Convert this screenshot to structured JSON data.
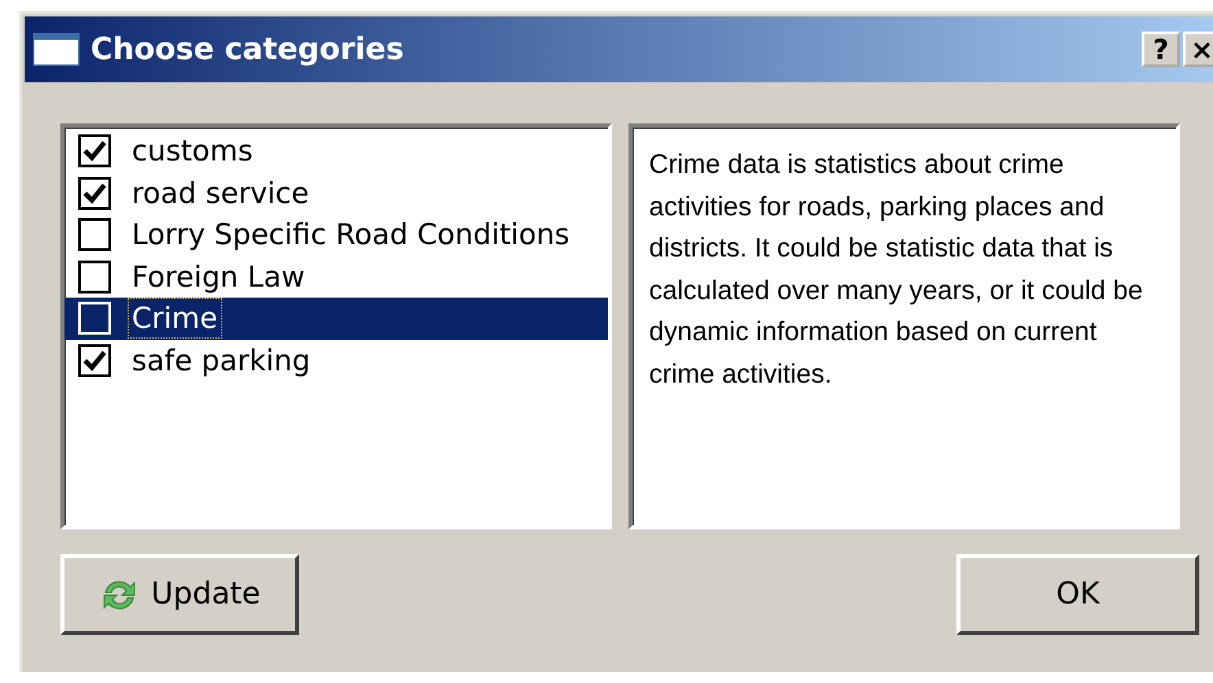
{
  "window": {
    "title": "Choose categories",
    "title_buttons": [
      "?",
      "×"
    ]
  },
  "categories": [
    {
      "label": "customs",
      "checked": true,
      "selected": false
    },
    {
      "label": "road service",
      "checked": true,
      "selected": false
    },
    {
      "label": "Lorry Specific Road Conditions",
      "checked": false,
      "selected": false
    },
    {
      "label": "Foreign Law",
      "checked": false,
      "selected": false
    },
    {
      "label": "Crime",
      "checked": false,
      "selected": true
    },
    {
      "label": "safe parking",
      "checked": true,
      "selected": false
    }
  ],
  "description": "Crime data is statistics about crime activities for roads, parking places and districts. It could be statistic data that is calculated over many years, or it could be dynamic information based on current crime activities.",
  "buttons": [
    {
      "kind": "update",
      "label": "Update"
    },
    {
      "kind": "ok",
      "label": "OK"
    }
  ]
}
